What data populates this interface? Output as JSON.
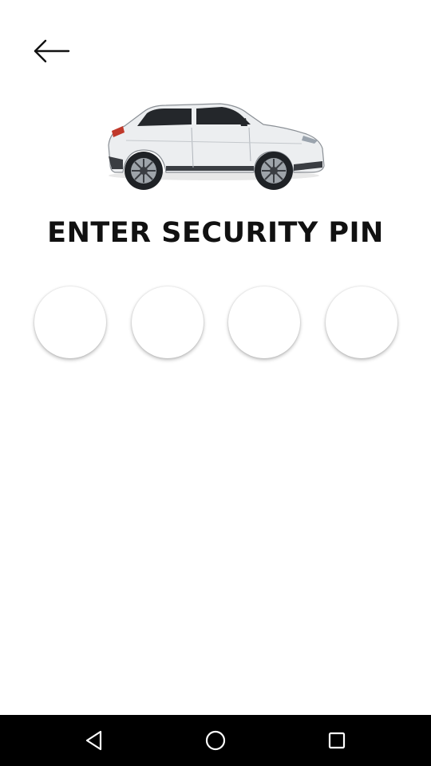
{
  "header": {
    "back_icon": "arrow-left-icon"
  },
  "hero": {
    "image": "car-suv-white-image"
  },
  "title": "ENTER SECURITY PIN",
  "pin": {
    "digits": [
      "",
      "",
      "",
      ""
    ]
  },
  "navbar": {
    "back_icon": "triangle-back-icon",
    "home_icon": "circle-home-icon",
    "recents_icon": "square-recents-icon"
  },
  "colors": {
    "background": "#ffffff",
    "title": "#111111",
    "navbar": "#000000",
    "car_body": "#eceef0"
  }
}
